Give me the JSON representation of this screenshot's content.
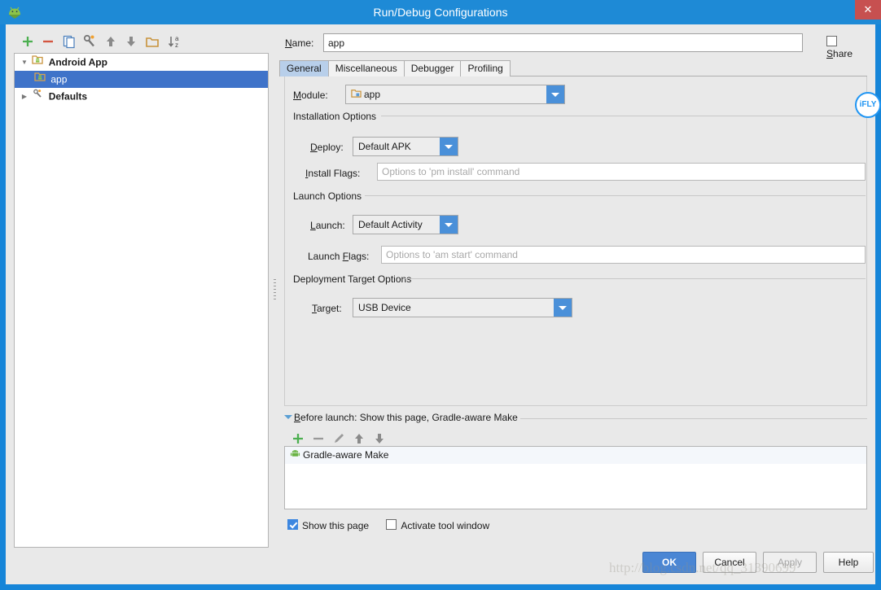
{
  "window": {
    "title": "Run/Debug Configurations",
    "app_icon": "android-studio-icon",
    "close_label": "✕"
  },
  "left_pane": {
    "toolbar": [
      {
        "name": "add-configuration-button",
        "glyph": "+"
      },
      {
        "name": "remove-configuration-button",
        "glyph": "−"
      },
      {
        "name": "copy-configuration-button",
        "glyph": "copy-icon"
      },
      {
        "name": "edit-defaults-button",
        "glyph": "wrench-icon"
      },
      {
        "name": "move-up-button",
        "glyph": "↑"
      },
      {
        "name": "move-down-button",
        "glyph": "↓"
      },
      {
        "name": "create-folder-button",
        "glyph": "folder-icon"
      },
      {
        "name": "sort-configurations-button",
        "glyph": "sort-az-icon"
      }
    ],
    "tree": [
      {
        "label": "Android App",
        "twisty": "▼",
        "icon": "android-app-icon",
        "bold": true,
        "selected": false,
        "indent": 0
      },
      {
        "label": "app",
        "twisty": "",
        "icon": "android-app-icon",
        "bold": false,
        "selected": true,
        "indent": 1
      },
      {
        "label": "Defaults",
        "twisty": "▶",
        "icon": "wrench-icon",
        "bold": true,
        "selected": false,
        "indent": 0
      }
    ]
  },
  "right_pane": {
    "name_label": "Name:",
    "name_label_mnemonic": "N",
    "name_value": "app",
    "share_label": "Share",
    "share_mnemonic": "S",
    "share_checked": false,
    "tabs": [
      {
        "label": "General",
        "active": true
      },
      {
        "label": "Miscellaneous",
        "active": false
      },
      {
        "label": "Debugger",
        "active": false
      },
      {
        "label": "Profiling",
        "active": false
      }
    ],
    "module": {
      "label": "Module:",
      "mnemonic": "M",
      "value": "app",
      "icon": "android-module-icon"
    },
    "sections": {
      "installation": {
        "title": "Installation Options",
        "deploy": {
          "label": "Deploy:",
          "mnemonic": "D",
          "value": "Default APK"
        },
        "install_flags": {
          "label": "Install Flags:",
          "mnemonic": "I",
          "value": "",
          "placeholder": "Options to 'pm install' command"
        }
      },
      "launch": {
        "title": "Launch Options",
        "launch": {
          "label": "Launch:",
          "mnemonic": "L",
          "value": "Default Activity"
        },
        "launch_flags": {
          "label": "Launch Flags:",
          "mnemonic": "F",
          "value": "",
          "placeholder": "Options to 'am start' command"
        }
      },
      "deployment": {
        "title": "Deployment Target Options",
        "target": {
          "label": "Target:",
          "mnemonic": "T",
          "value": "USB Device"
        }
      }
    },
    "before_launch": {
      "header": "Before launch: Show this page, Gradle-aware Make",
      "header_mnemonic": "B",
      "toolbar": [
        {
          "name": "add-task-button",
          "glyph": "+"
        },
        {
          "name": "remove-task-button",
          "glyph": "−"
        },
        {
          "name": "edit-task-button",
          "glyph": "pencil-icon"
        },
        {
          "name": "task-move-up-button",
          "glyph": "↑"
        },
        {
          "name": "task-move-down-button",
          "glyph": "↓"
        }
      ],
      "items": [
        {
          "label": "Gradle-aware Make",
          "icon": "android-robot-icon"
        }
      ]
    },
    "checkboxes": [
      {
        "label": "Show this page",
        "checked": true,
        "name": "show-this-page-checkbox"
      },
      {
        "label": "Activate tool window",
        "checked": false,
        "name": "activate-tool-window-checkbox"
      }
    ]
  },
  "buttons": [
    {
      "label": "OK",
      "style": "primary",
      "name": "ok-button"
    },
    {
      "label": "Cancel",
      "style": "normal",
      "name": "cancel-button"
    },
    {
      "label": "Apply",
      "style": "disabled",
      "name": "apply-button"
    },
    {
      "label": "Help",
      "style": "normal",
      "name": "help-button"
    }
  ],
  "overlay": {
    "watermark": "http://blog.csdn.net/qq_31390699",
    "ifly_badge": "iFLY"
  },
  "colors": {
    "titlebar": "#1e8ad6",
    "accent": "#4a90d9",
    "selection": "#3f73c9",
    "close": "#c75050",
    "panel": "#e9e9e9"
  }
}
